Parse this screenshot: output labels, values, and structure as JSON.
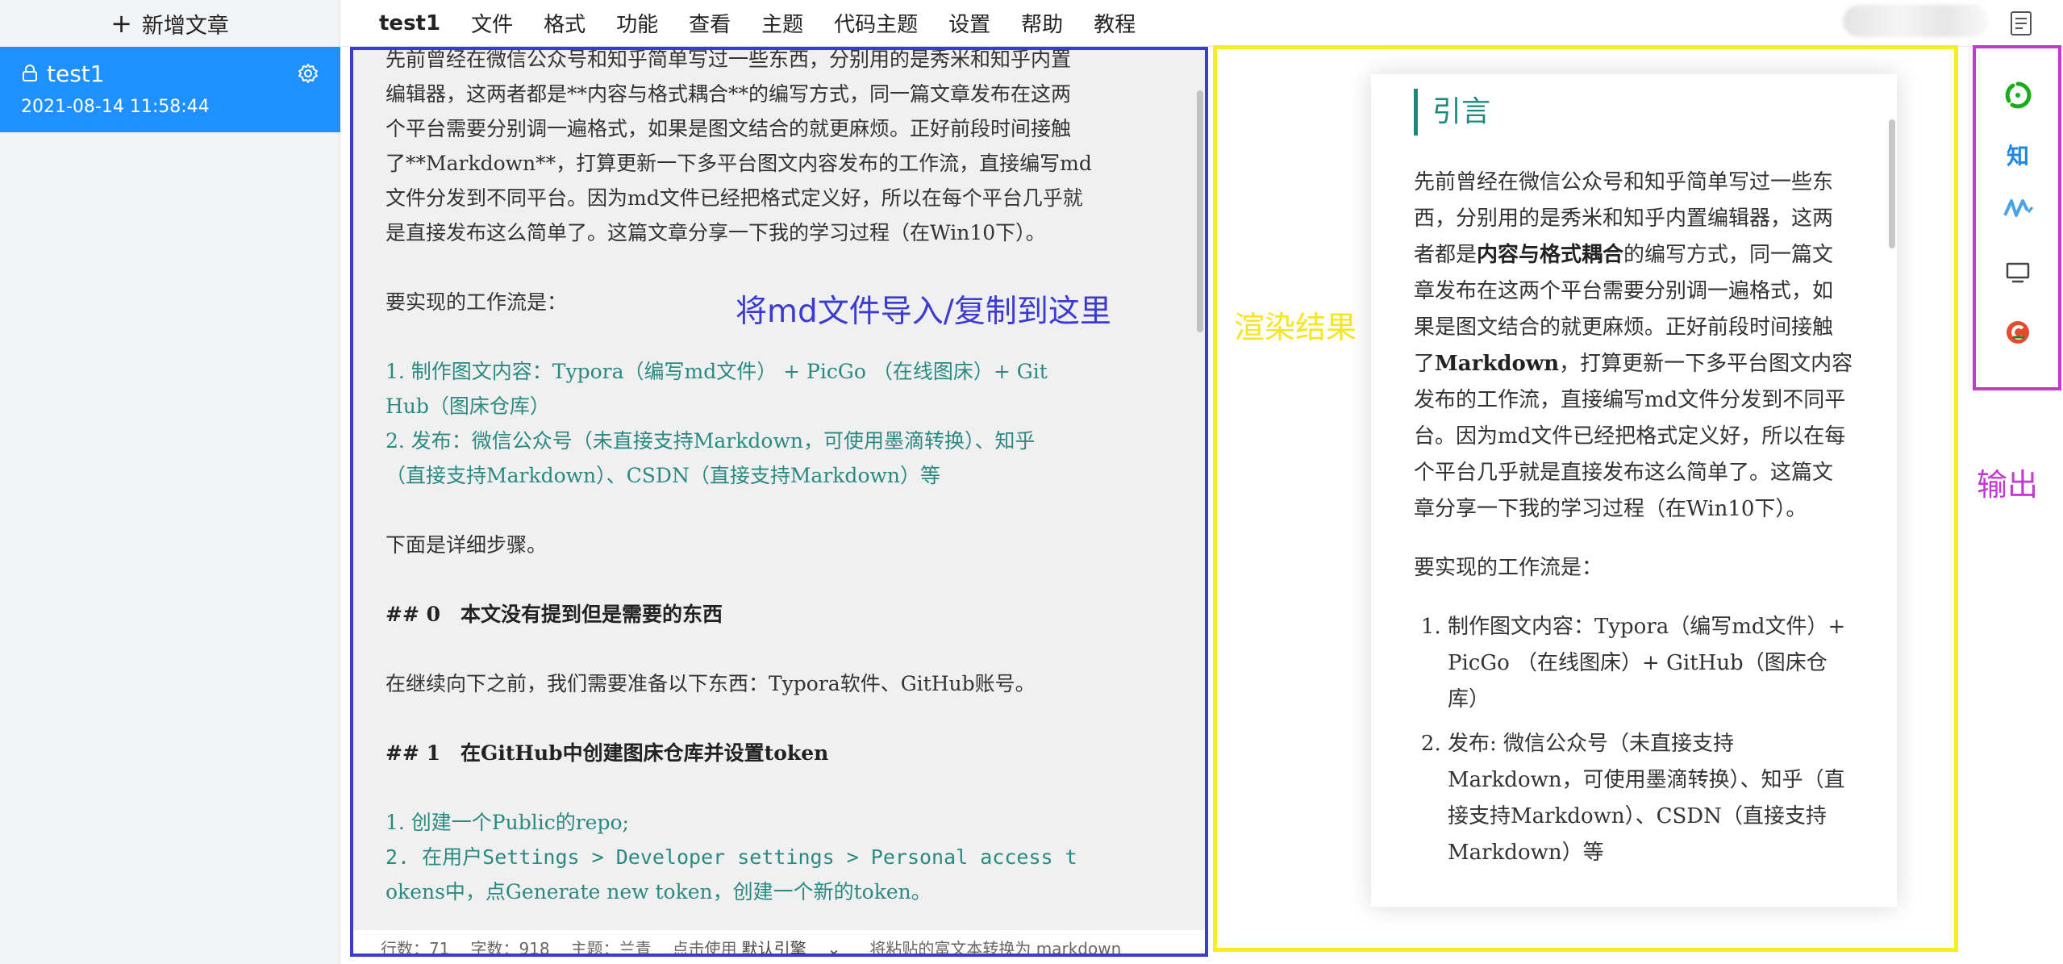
{
  "sidebar": {
    "add_label": "新增文章",
    "article": {
      "title": "test1",
      "date": "2021-08-14 11:58:44"
    }
  },
  "menubar": {
    "doc_name": "test1",
    "items": [
      "文件",
      "格式",
      "功能",
      "查看",
      "主题",
      "代码主题",
      "设置",
      "帮助",
      "教程"
    ]
  },
  "editor": {
    "lines": [
      "先前曾经在微信公众号和知乎简单写过一些东西，分别用的是秀米和知乎内置",
      "编辑器，这两者都是**内容与格式耦合**的编写方式，同一篇文章发布在这两",
      "个平台需要分别调一遍格式，如果是图文结合的就更麻烦。正好前段时间接触",
      "了**Markdown**，打算更新一下多平台图文内容发布的工作流，直接编写md",
      "文件分发到不同平台。因为md文件已经把格式定义好，所以在每个平台几乎就",
      "是直接发布这么简单了。这篇文章分享一下我的学习过程（在Win10下）。",
      "要实现的工作流是：",
      "1. 制作图文内容：Typora（编写md文件） + PicGo （在线图床）+ Git",
      "Hub（图床仓库）",
      "2. 发布：微信公众号（未直接支持Markdown，可使用墨滴转换）、知乎",
      "（直接支持Markdown）、CSDN（直接支持Markdown）等",
      "下面是详细步骤。",
      "## 0　本文没有提到但是需要的东西",
      "在继续向下之前，我们需要准备以下东西：Typora软件、GitHub账号。",
      "## 1　在GitHub中创建图床仓库并设置token",
      "1. 创建一个Public的repo;",
      "2. 在用户Settings > Developer settings > Personal access t",
      "okens中，点Generate new token，创建一个新的token。"
    ]
  },
  "statusbar": {
    "lines": "行数：71",
    "chars": "字数：918",
    "theme": "主题：兰青",
    "hint": "点击使用",
    "engine": "默认引擎",
    "convert": "将粘贴的富文本转换为 markdown"
  },
  "annotations": {
    "editor": "将md文件导入/复制到这里",
    "render": "渲染结果",
    "output": "输出"
  },
  "preview": {
    "heading": "引言",
    "para1_a": "先前曾经在微信公众号和知乎简单写过一些东西，分别用的是秀米和知乎内置编辑器，这两者都是",
    "para1_b1": "内容与格式耦合",
    "para1_c": "的编写方式，同一篇文章发布在这两个平台需要分别调一遍格式，如果是图文结合的就更麻烦。正好前段时间接触了",
    "para1_b2": "Markdown",
    "para1_d": "，打算更新一下多平台图文内容发布的工作流，直接编写md文件分发到不同平台。因为md文件已经把格式定义好，所以在每个平台几乎就是直接发布这么简单了。这篇文章分享一下我的学习过程（在Win10下）。",
    "para2": "要实现的工作流是：",
    "list": [
      "制作图文内容：Typora（编写md文件）+ PicGo （在线图床）+ GitHub（图床仓库）",
      "发布: 微信公众号（未直接支持Markdown，可使用墨滴转换）、知乎（直接支持Markdown）、CSDN（直接支持Markdown）等"
    ]
  },
  "output_icons": {
    "zhihu": "知"
  },
  "colors": {
    "sidebar_active": "#1e90ff",
    "editor_box": "#3b3bd1",
    "render_box": "#f6ee20",
    "output_box": "#c23ad0",
    "heading_accent": "#1a8a7e"
  }
}
